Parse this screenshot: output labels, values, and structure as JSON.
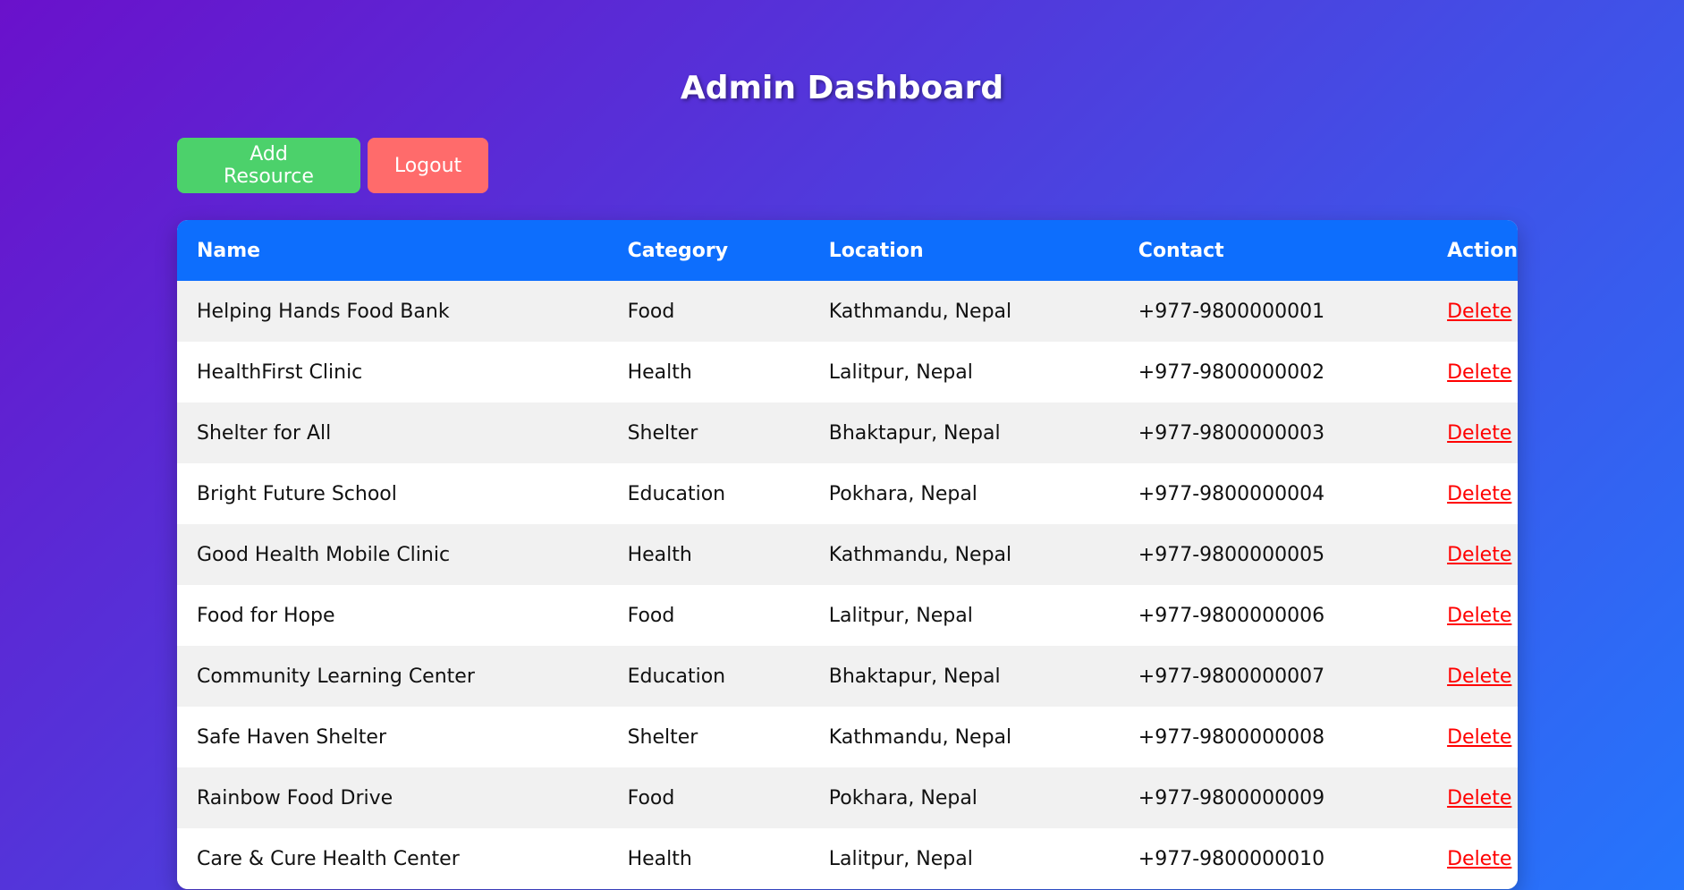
{
  "header": {
    "title": "Admin Dashboard"
  },
  "toolbar": {
    "add_label": "Add Resource",
    "logout_label": "Logout"
  },
  "table": {
    "columns": [
      "Name",
      "Category",
      "Location",
      "Contact",
      "Action"
    ],
    "rows": [
      {
        "name": "Helping Hands Food Bank",
        "category": "Food",
        "location": "Kathmandu, Nepal",
        "contact": "+977-9800000001",
        "action": "Delete"
      },
      {
        "name": "HealthFirst Clinic",
        "category": "Health",
        "location": "Lalitpur, Nepal",
        "contact": "+977-9800000002",
        "action": "Delete"
      },
      {
        "name": "Shelter for All",
        "category": "Shelter",
        "location": "Bhaktapur, Nepal",
        "contact": "+977-9800000003",
        "action": "Delete"
      },
      {
        "name": "Bright Future School",
        "category": "Education",
        "location": "Pokhara, Nepal",
        "contact": "+977-9800000004",
        "action": "Delete"
      },
      {
        "name": "Good Health Mobile Clinic",
        "category": "Health",
        "location": "Kathmandu, Nepal",
        "contact": "+977-9800000005",
        "action": "Delete"
      },
      {
        "name": "Food for Hope",
        "category": "Food",
        "location": "Lalitpur, Nepal",
        "contact": "+977-9800000006",
        "action": "Delete"
      },
      {
        "name": "Community Learning Center",
        "category": "Education",
        "location": "Bhaktapur, Nepal",
        "contact": "+977-9800000007",
        "action": "Delete"
      },
      {
        "name": "Safe Haven Shelter",
        "category": "Shelter",
        "location": "Kathmandu, Nepal",
        "contact": "+977-9800000008",
        "action": "Delete"
      },
      {
        "name": "Rainbow Food Drive",
        "category": "Food",
        "location": "Pokhara, Nepal",
        "contact": "+977-9800000009",
        "action": "Delete"
      },
      {
        "name": "Care & Cure Health Center",
        "category": "Health",
        "location": "Lalitpur, Nepal",
        "contact": "+977-9800000010",
        "action": "Delete"
      }
    ]
  },
  "colors": {
    "gradient_start": "#6a11cb",
    "gradient_end": "#2575fc",
    "header_bg": "#0d6efd",
    "add_button": "#4cd16b",
    "logout_button": "#ff6b6b",
    "delete_link": "#ff0000"
  }
}
